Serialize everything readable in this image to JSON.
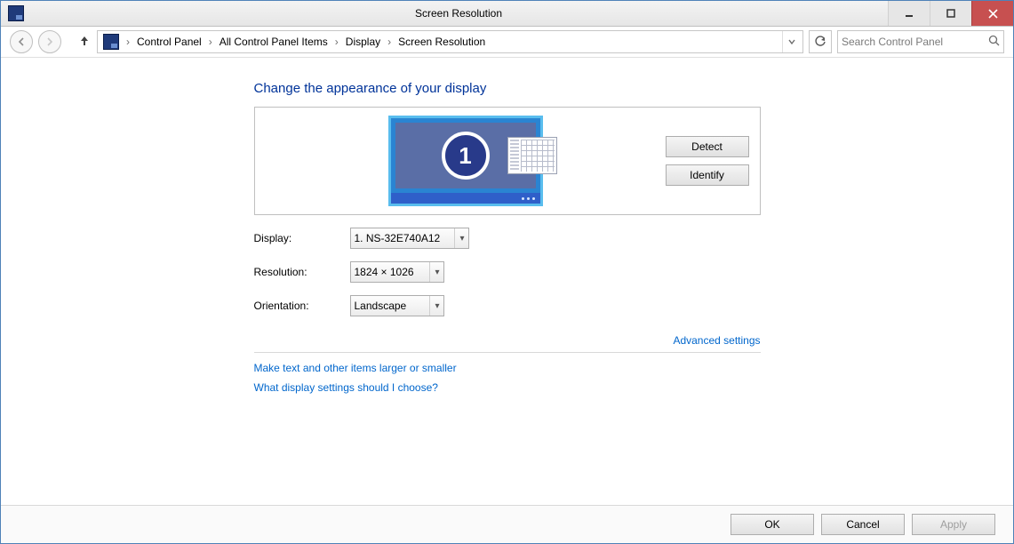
{
  "window": {
    "title": "Screen Resolution"
  },
  "breadcrumb": {
    "items": [
      "Control Panel",
      "All Control Panel Items",
      "Display",
      "Screen Resolution"
    ]
  },
  "search": {
    "placeholder": "Search Control Panel"
  },
  "heading": "Change the appearance of your display",
  "monitor": {
    "number": "1"
  },
  "buttons": {
    "detect": "Detect",
    "identify": "Identify"
  },
  "form": {
    "display_label": "Display:",
    "display_value": "1. NS-32E740A12",
    "resolution_label": "Resolution:",
    "resolution_value": "1824 × 1026",
    "orientation_label": "Orientation:",
    "orientation_value": "Landscape"
  },
  "links": {
    "advanced": "Advanced settings",
    "textsize": "Make text and other items larger or smaller",
    "help": "What display settings should I choose?"
  },
  "bottom": {
    "ok": "OK",
    "cancel": "Cancel",
    "apply": "Apply"
  }
}
